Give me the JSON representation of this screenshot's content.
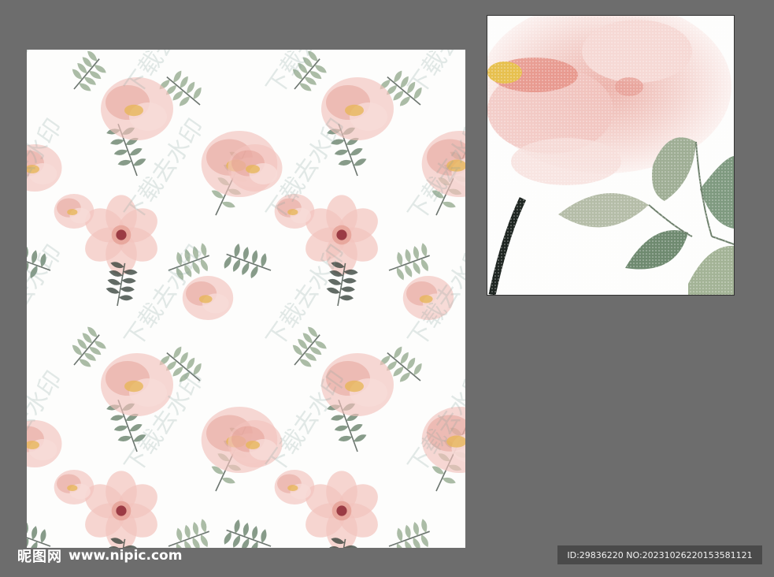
{
  "pattern": {
    "watermark_lettering": "下载去水印",
    "colors": {
      "background": "#fdfdfc",
      "petal": "#f2c3bd",
      "petal_dark": "#e39a8f",
      "center": "#9b3b44",
      "stamen": "#e7b65a",
      "leaf": "#8fa58a",
      "leaf_dark": "#5f7a63",
      "stem": "#2e3a33"
    }
  },
  "footer": {
    "logo_text": "昵图网",
    "site_url": "www.nipic.com",
    "id_text": "ID:29836220 NO:20231026220153581121"
  }
}
